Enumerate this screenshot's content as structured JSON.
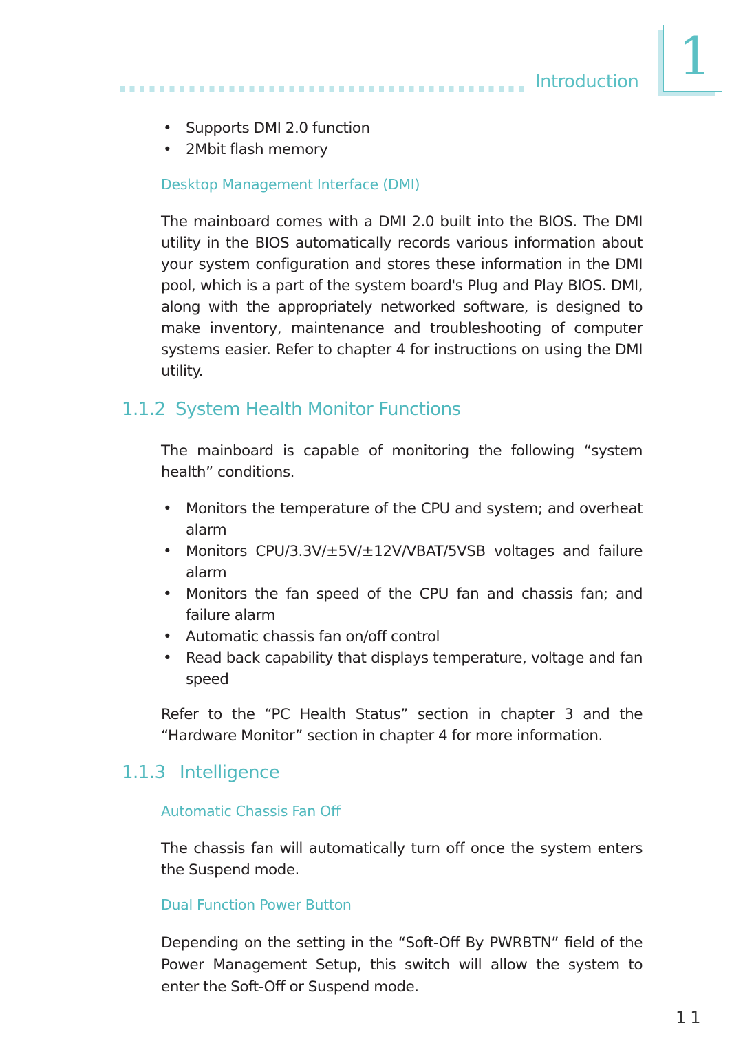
{
  "header": {
    "chapter_title": "Introduction",
    "chapter_number": "1"
  },
  "top_bullets": [
    "Supports DMI 2.0 function",
    "2Mbit flash memory"
  ],
  "dmi": {
    "heading": "Desktop Management Interface (DMI)",
    "paragraph": "The mainboard comes with a DMI 2.0 built into the BIOS. The DMI utility in the BIOS automatically records various information about your system configuration and stores these information in the DMI pool, which is a part of the system board's Plug and Play BIOS. DMI, along with the appropriately networked software, is designed to make inventory, maintenance and troubleshooting of computer systems easier. Refer to chapter 4 for instructions on using the DMI utility."
  },
  "section_112": {
    "number": "1.1.2",
    "title": "System Health Monitor Functions",
    "intro": "The mainboard is capable of monitoring the following “system health” conditions.",
    "bullets": [
      "Monitors the temperature of the CPU and system; and overheat alarm",
      "Monitors CPU/3.3V/±5V/±12V/VBAT/5VSB voltages and failure alarm",
      "Monitors the fan speed of the CPU fan and chassis fan; and failure alarm",
      "Automatic chassis fan on/off control",
      "Read back capability that displays temperature, voltage and fan speed"
    ],
    "refer": "Refer to the “PC Health Status” section in chapter 3 and the “Hardware Monitor” section in chapter 4 for more information."
  },
  "section_113": {
    "number": "1.1.3",
    "title": "Intelligence",
    "subsections": [
      {
        "heading": "Automatic Chassis Fan Off",
        "paragraph": "The chassis fan will automatically turn off once the system enters the Suspend mode."
      },
      {
        "heading": "Dual Function Power Button",
        "paragraph": "Depending on the setting in the “Soft-Off By PWRBTN” field of the Power Management Setup, this switch will allow the system to enter the Soft-Off or Suspend mode."
      }
    ]
  },
  "footer": {
    "page_number": "11"
  },
  "colors": {
    "accent": "#4fb8bd",
    "accent_light": "#bfe6ea",
    "text": "#231f20"
  },
  "bullet_glyph": "•"
}
